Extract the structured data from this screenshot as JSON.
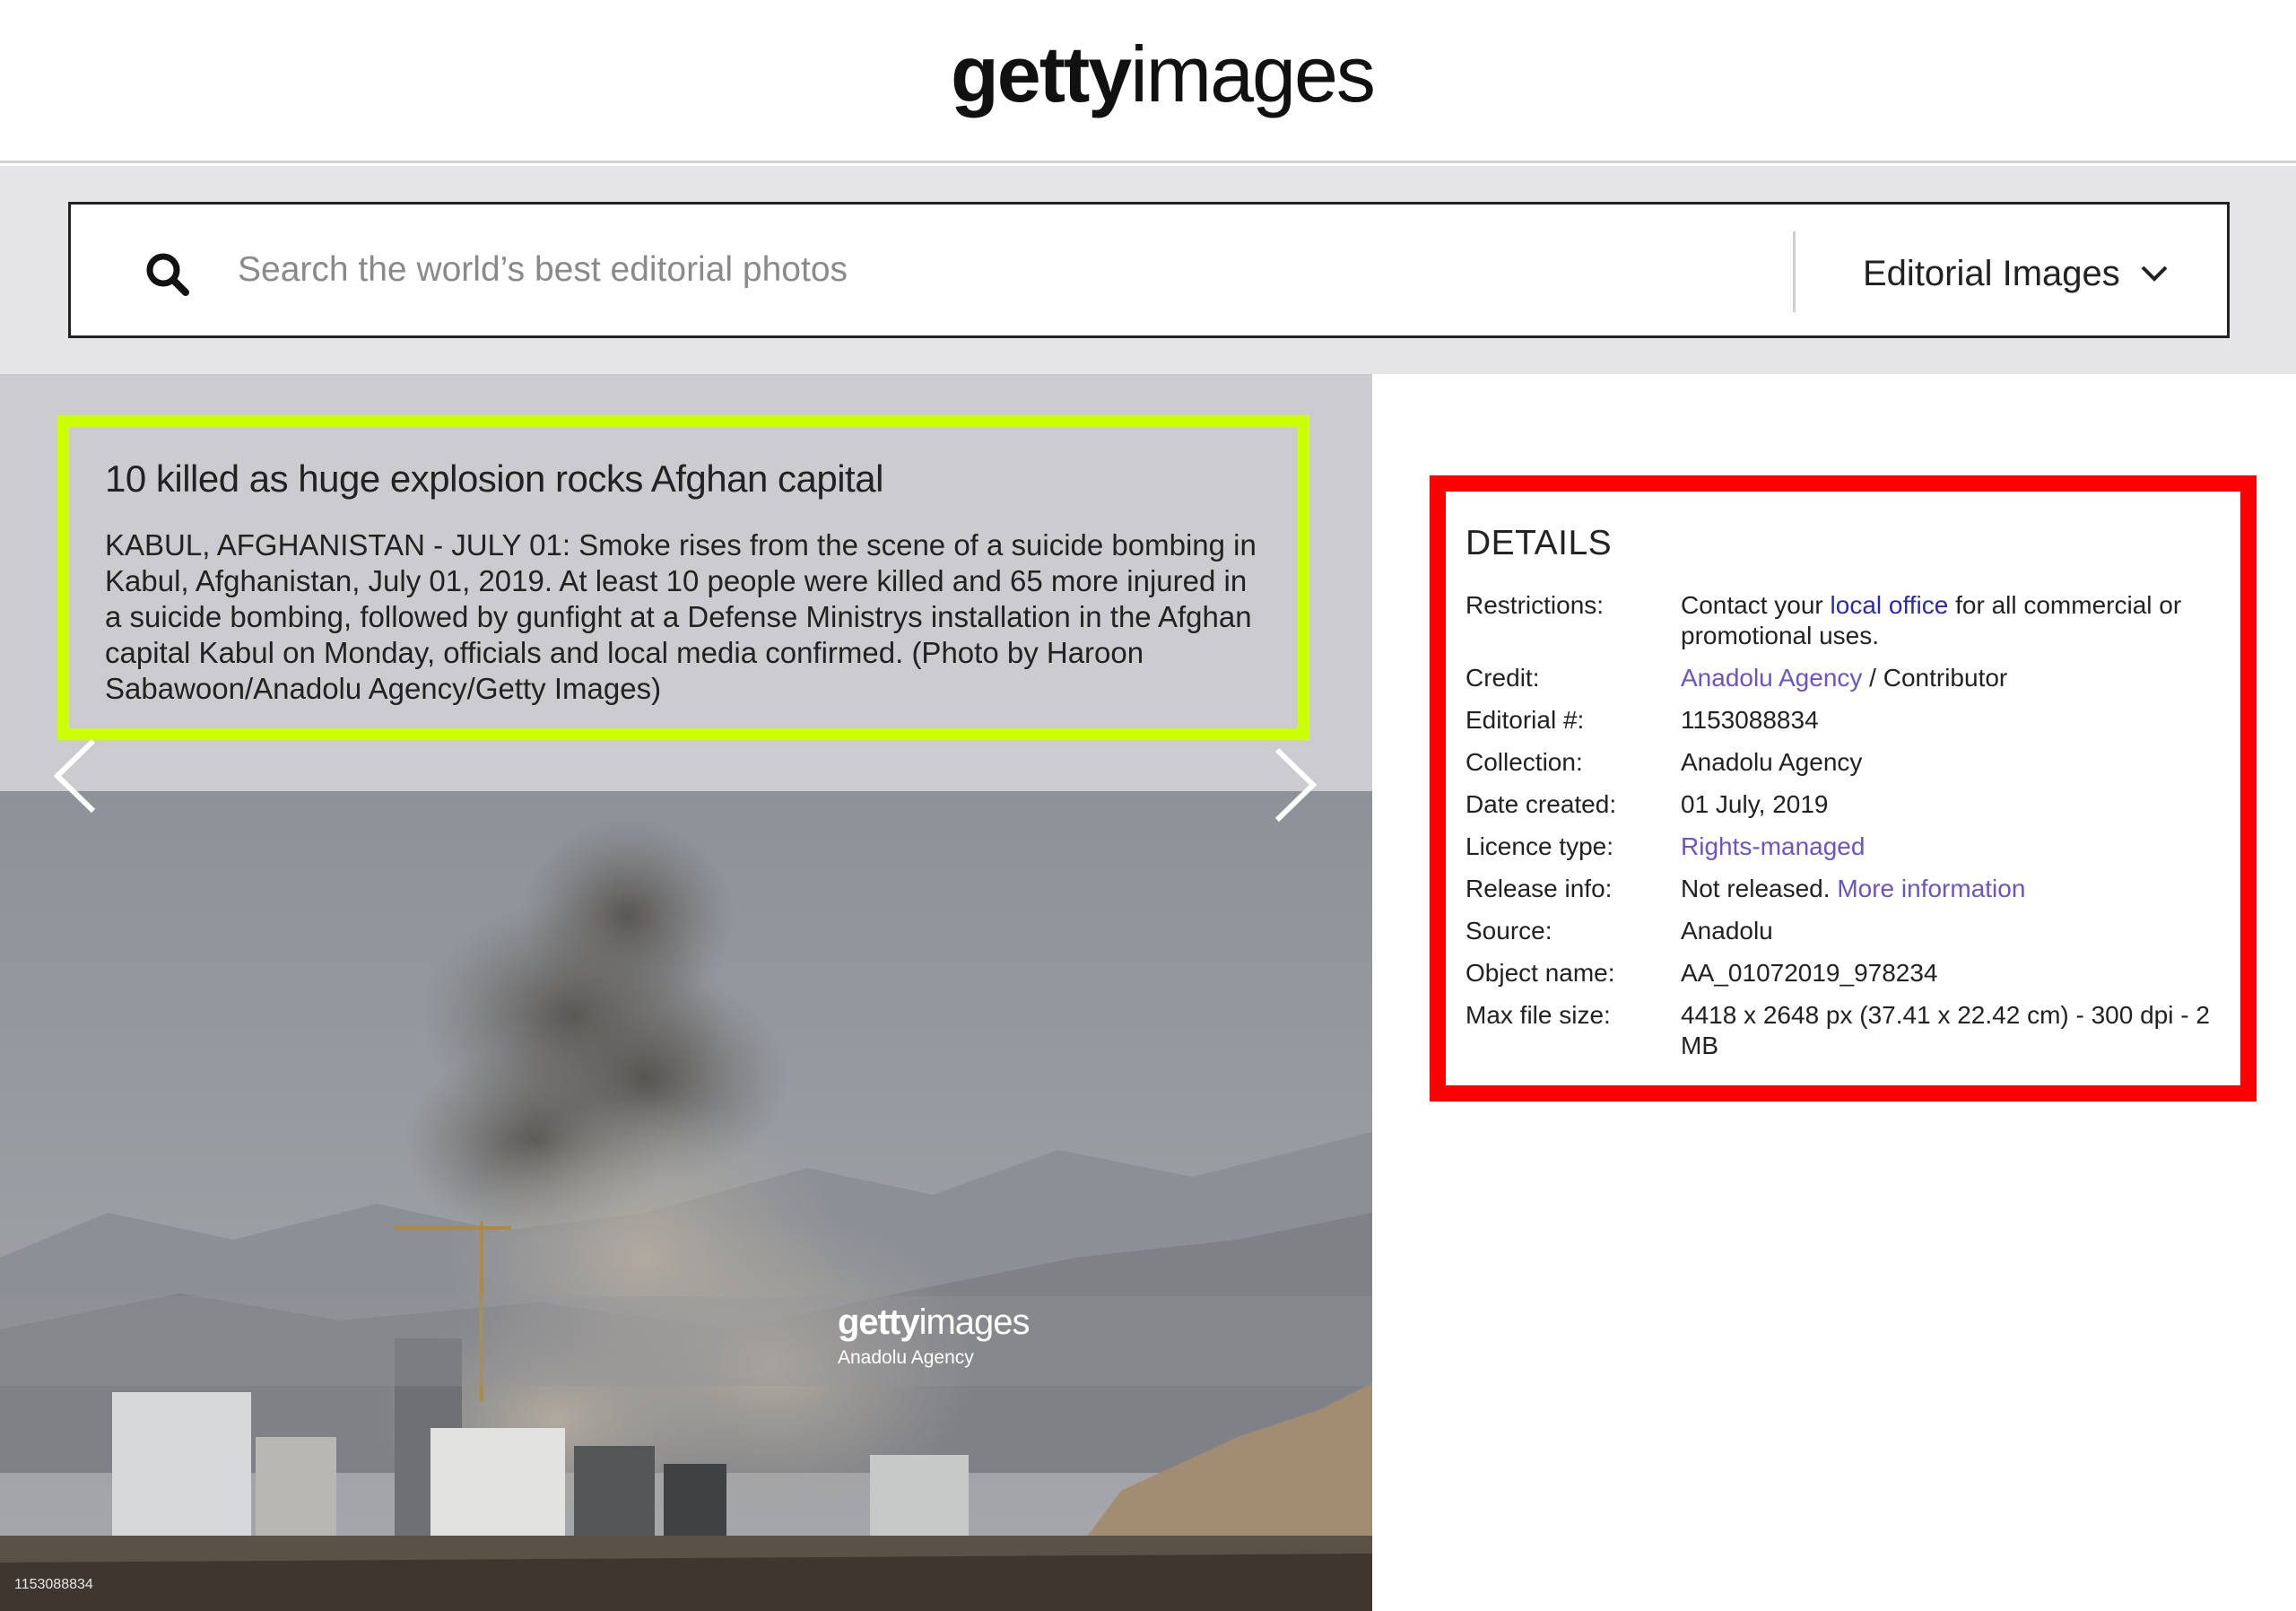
{
  "header": {
    "logo_bold": "getty",
    "logo_light": "images"
  },
  "search": {
    "placeholder": "Search the world’s best editorial photos",
    "type_label": "Editorial Images"
  },
  "caption": {
    "title": "10 killed as huge explosion rocks Afghan capital",
    "text": "KABUL, AFGHANISTAN - JULY 01: Smoke rises from the scene of a suicide bombing in Kabul, Afghanistan, July 01, 2019. At least 10 people were killed and 65 more injured in a suicide bombing, followed by gunfight at a Defense Ministrys installation in the Afghan capital Kabul on Monday, officials and local media confirmed. (Photo by Haroon Sabawoon/Anadolu Agency/Getty Images)"
  },
  "photo": {
    "watermark_bold": "getty",
    "watermark_light": "images",
    "watermark_sub": "Anadolu Agency",
    "id_label": "1153088834"
  },
  "details": {
    "title": "DETAILS",
    "restrictions_label": "Restrictions:",
    "restrictions_pre": "Contact your ",
    "restrictions_link": "local office",
    "restrictions_post": " for all commercial or promotional uses.",
    "credit_label": "Credit:",
    "credit_link": "Anadolu Agency",
    "credit_post": " / Contributor",
    "editorial_label": "Editorial #:",
    "editorial_value": "1153088834",
    "collection_label": "Collection:",
    "collection_value": "Anadolu Agency",
    "date_label": "Date created:",
    "date_value": "01 July, 2019",
    "licence_label": "Licence type:",
    "licence_link": "Rights-managed",
    "release_label": "Release info:",
    "release_pre": "Not released. ",
    "release_link": "More information",
    "source_label": "Source:",
    "source_value": "Anadolu",
    "object_label": "Object name:",
    "object_value": "AA_01072019_978234",
    "filesize_label": "Max file size:",
    "filesize_value": "4418 x 2648 px (37.41 x 22.42 cm) - 300 dpi - 2 MB"
  },
  "colors": {
    "caption_border": "#ccff00",
    "details_border": "#ff0000",
    "link": "#6a54c6"
  }
}
